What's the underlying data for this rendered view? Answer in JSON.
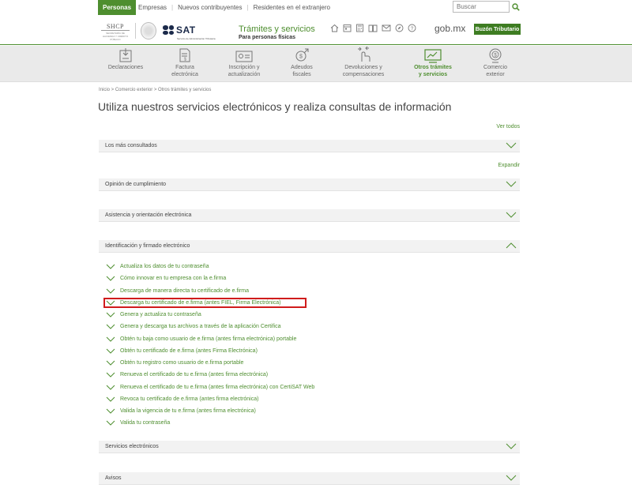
{
  "topbar": {
    "tabs": [
      "Personas",
      "Empresas",
      "Nuevos contribuyentes",
      "Residentes en el extranjero"
    ],
    "search_placeholder": "Buscar"
  },
  "header": {
    "shcp_text": "SHCP",
    "shcp_sub": "SECRETARÍA DE HACIENDA Y CRÉDITO PÚBLICO",
    "sat_text": "SAT",
    "sat_sub": "Servicio de Administración Tributaria",
    "title": "Trámites y servicios",
    "subtitle": "Para personas físicas",
    "gobmx": "gob.mx",
    "buzon_label": "Buzón Tributario",
    "icons": [
      "home-icon",
      "calendar-icon",
      "calculator-icon",
      "book-icon",
      "mail-icon",
      "compass-icon",
      "help-icon"
    ]
  },
  "nav": {
    "items": [
      {
        "label1": "Declaraciones",
        "label2": "",
        "icon": "declaraciones-icon"
      },
      {
        "label1": "Factura",
        "label2": "electrónica",
        "icon": "factura-icon"
      },
      {
        "label1": "Inscripción y",
        "label2": "actualización",
        "icon": "inscripcion-icon"
      },
      {
        "label1": "Adeudos",
        "label2": "fiscales",
        "icon": "adeudos-icon"
      },
      {
        "label1": "Devoluciones y",
        "label2": "compensaciones",
        "icon": "devoluciones-icon"
      },
      {
        "label1": "Otros trámites",
        "label2": "y servicios",
        "icon": "otros-tramites-icon"
      },
      {
        "label1": "Comercio",
        "label2": "exterior",
        "icon": "comercio-icon"
      }
    ],
    "active_index": 5
  },
  "breadcrumb": "Inicio > Comercio exterior > Otros trámites y servicios",
  "page_title": "Utiliza nuestros servicios electrónicos y realiza consultas de información",
  "ver_todos": "Ver todos",
  "expandir": "Expandir",
  "sections": {
    "mas_consultados": "Los más consultados",
    "opinion": "Opinión de cumplimiento",
    "asistencia": "Asistencia y orientación electrónica",
    "identificacion": "Identificación y firmado electrónico",
    "servicios": "Servicios electrónicos",
    "avisos": "Avisos"
  },
  "links": [
    "Actualiza los datos de tu contraseña",
    "Cómo innovar en tu empresa con la e.firma",
    "Descarga de manera directa tu certificado de e.firma",
    "Descarga tu certificado de e.firma (antes FIEL, Firma Electrónica)",
    "Genera y actualiza tu contraseña",
    "Genera y descarga tus archivos a través de la aplicación Certifica",
    "Obtén tu baja como usuario de e.firma (antes firma electrónica) portable",
    "Obtén tu certificado de e.firma (antes Firma Electrónica)",
    "Obtén tu registro como usuario de e.firma portable",
    "Renueva el certificado de tu e.firma (antes firma electrónica)",
    "Renueva el certificado de tu e.firma (antes firma electrónica) con CertiSAT Web",
    "Revoca tu certificado de e.firma (antes firma electrónica)",
    "Valida la vigencia de tu e.firma (antes firma electrónica)",
    "Valida tu contraseña"
  ],
  "colors": {
    "accent": "#4e8e2f",
    "highlight": "#d01c1c",
    "section_bg": "#f2f2f2",
    "nav_bg": "#eaeaea"
  }
}
